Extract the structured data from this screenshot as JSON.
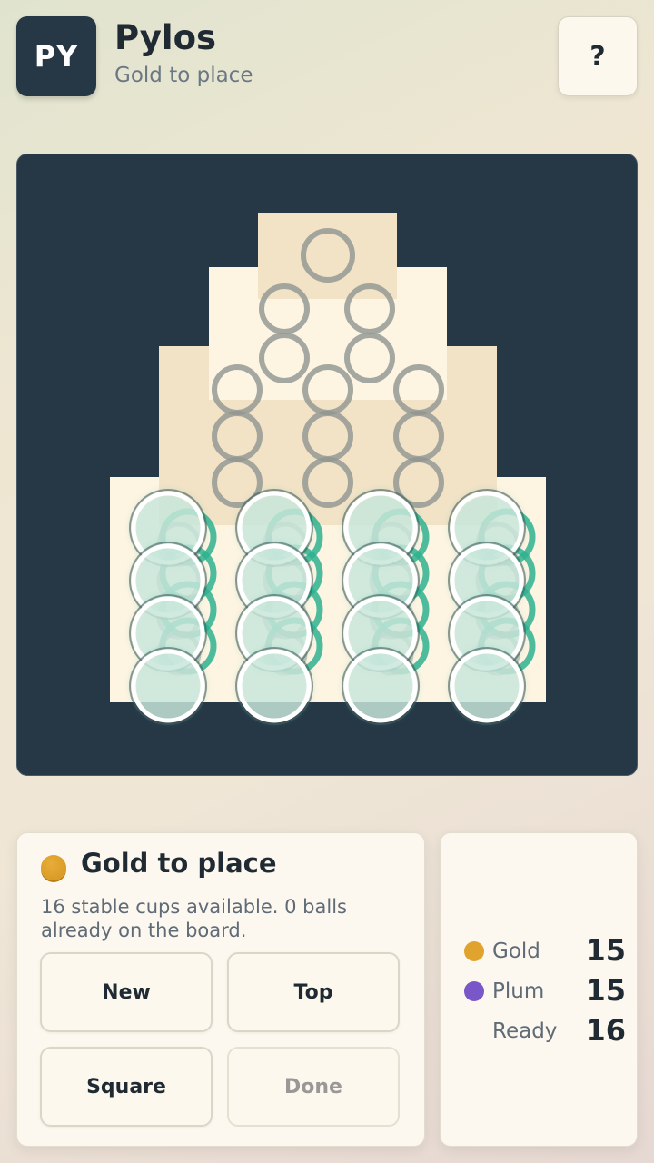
{
  "header": {
    "logo_text": "PY",
    "title": "Pylos",
    "subtitle": "Gold to place",
    "help_label": "?"
  },
  "colors": {
    "gold": "#e0a32e",
    "plum": "#7a57c8",
    "board_bg": "#263746",
    "accent_green": "#2fb28f",
    "tier_light": "#fdf4e2",
    "tier_dark": "#f2e2c6"
  },
  "board": {
    "tiers": [
      {
        "level": 1,
        "size": 4,
        "open_cups": 16
      },
      {
        "level": 2,
        "size": 3,
        "open_cups": 9
      },
      {
        "level": 3,
        "size": 2,
        "open_cups": 4
      },
      {
        "level": 4,
        "size": 1,
        "open_cups": 1
      }
    ]
  },
  "status": {
    "turn_title": "Gold to place",
    "message": "16 stable cups available. 0 balls already on the board.",
    "buttons": {
      "new": "New",
      "top": "Top",
      "square": "Square",
      "done": "Done"
    }
  },
  "scores": {
    "gold_label": "Gold",
    "gold_value": "15",
    "plum_label": "Plum",
    "plum_value": "15",
    "ready_label": "Ready",
    "ready_value": "16"
  }
}
